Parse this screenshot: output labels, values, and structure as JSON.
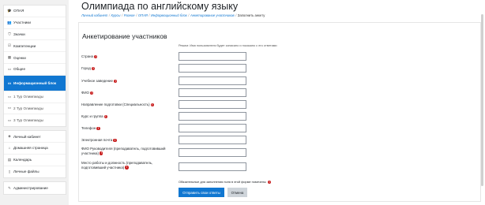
{
  "sidebar": {
    "course_items": [
      {
        "icon": "graduation-cap-icon",
        "glyph": "🎓",
        "label": "OПАЯ"
      },
      {
        "icon": "users-icon",
        "glyph": "👥",
        "label": "Участники"
      },
      {
        "icon": "shield-icon",
        "glyph": "⛉",
        "label": "Значки"
      },
      {
        "icon": "checkbox-icon",
        "glyph": "☑",
        "label": "Компетенции"
      },
      {
        "icon": "grades-icon",
        "glyph": "▦",
        "label": "Оценки"
      },
      {
        "icon": "folder-icon",
        "glyph": "▭",
        "label": "Общее"
      },
      {
        "icon": "folder-icon",
        "glyph": "▭",
        "label": "Информационный блок",
        "active": true
      },
      {
        "icon": "folder-icon",
        "glyph": "▭",
        "label": "1 Тур Олимпиады"
      },
      {
        "icon": "folder-icon",
        "glyph": "▭",
        "label": "2 Тур Олимпиады"
      },
      {
        "icon": "folder-icon",
        "glyph": "▭",
        "label": "3 Тур Олимпиады"
      }
    ],
    "site_items": [
      {
        "icon": "dashboard-icon",
        "glyph": "◈",
        "label": "Личный кабинет"
      },
      {
        "icon": "home-icon",
        "glyph": "⌂",
        "label": "Домашняя страница"
      },
      {
        "icon": "calendar-icon",
        "glyph": "▤",
        "label": "Календарь"
      },
      {
        "icon": "file-icon",
        "glyph": "▯",
        "label": "Личные файлы"
      }
    ],
    "admin_items": [
      {
        "icon": "wrench-icon",
        "glyph": "✎",
        "label": "Администрирование"
      }
    ]
  },
  "header": {
    "title": "Олимпиада по английскому языку",
    "breadcrumb": [
      "Личный кабинет",
      "Курсы",
      "Разное",
      "ОПАЯ",
      "Информационный блок",
      "Анкетирование участников",
      "Заполнить анкету"
    ]
  },
  "form": {
    "title": "Анкетирование участников",
    "mode_note": "Режим: Имя пользователя будет записано и показано с его ответами",
    "fields": [
      {
        "label": "Страна",
        "value": ""
      },
      {
        "label": "Город",
        "value": ""
      },
      {
        "label": "Учебное заведение",
        "value": ""
      },
      {
        "label": "ФИО",
        "value": ""
      },
      {
        "label": "Направление подготовки (Специальность)",
        "value": ""
      },
      {
        "label": "Курс и группа",
        "value": ""
      },
      {
        "label": "Телефон",
        "value": ""
      },
      {
        "label": "Электронная почта",
        "value": ""
      },
      {
        "label": "ФИО Руководителя (преподаватель, подготовивший участника)",
        "value": ""
      },
      {
        "label": "Место работы и должность (преподаватель, подготовивший участника)",
        "value": ""
      }
    ],
    "required_note": "Обязательные для заполнения поля в этой форме помечены",
    "submit_label": "Отправить свои ответы",
    "cancel_label": "Отмена"
  },
  "colors": {
    "accent": "#1177d1",
    "required": "#c81e1e",
    "sidebar_bg": "#f1f1f1"
  }
}
